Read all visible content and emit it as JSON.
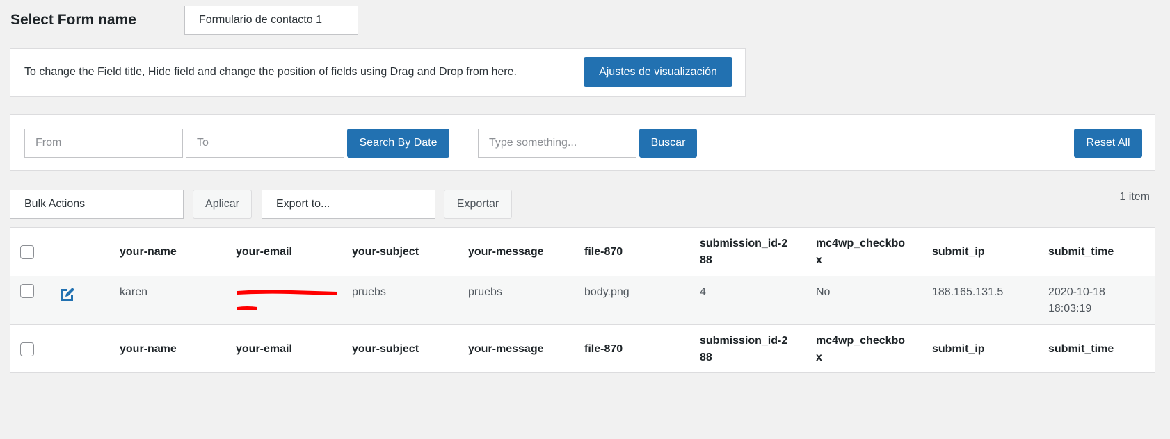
{
  "form_select": {
    "title": "Select Form name",
    "selected": "Formulario de contacto 1"
  },
  "notice": {
    "text": "To change the Field title, Hide field and change the position of fields using Drag and Drop from here.",
    "button_label": "Ajustes de visualización"
  },
  "search": {
    "from_placeholder": "From",
    "to_placeholder": "To",
    "date_button": "Search By Date",
    "type_placeholder": "Type something...",
    "buscar_button": "Buscar",
    "reset_button": "Reset All"
  },
  "actions": {
    "bulk_selected": "Bulk Actions",
    "apply_button": "Aplicar",
    "export_selected": "Export to...",
    "export_button": "Exportar"
  },
  "item_count": "1 item",
  "table": {
    "columns": {
      "name": "your-name",
      "email": "your-email",
      "subject": "your-subject",
      "message": "your-message",
      "file": "file-870",
      "subid_1": "submission_id-2",
      "subid_2": "88",
      "mc4_1": "mc4wp_checkbo",
      "mc4_2": "x",
      "ip": "submit_ip",
      "time": "submit_time"
    },
    "rows": [
      {
        "name": "karen",
        "subject": "pruebs",
        "message": "pruebs",
        "file": "body.png",
        "submission_id": "4",
        "mc4wp": "No",
        "ip": "188.165.131.5",
        "date": "2020-10-18",
        "time": "18:03:19"
      }
    ]
  },
  "colors": {
    "primary": "#2271b1",
    "redaction": "#ff0000",
    "background": "#f1f1f1"
  },
  "icons": [
    "edit-icon",
    "checkbox"
  ]
}
